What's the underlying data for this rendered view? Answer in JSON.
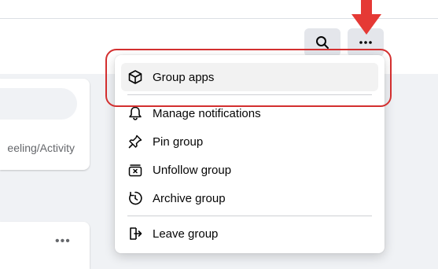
{
  "menu": {
    "items": [
      {
        "label": "Group apps",
        "icon": "cube-icon"
      },
      {
        "label": "Manage notifications",
        "icon": "bell-icon"
      },
      {
        "label": "Pin group",
        "icon": "pin-icon"
      },
      {
        "label": "Unfollow group",
        "icon": "unfollow-icon"
      },
      {
        "label": "Archive group",
        "icon": "archive-icon"
      },
      {
        "label": "Leave group",
        "icon": "exit-icon"
      }
    ]
  },
  "left_panel": {
    "fragment_text": "eeling/Activity"
  },
  "colors": {
    "annotation": "#e53935",
    "menu_hover": "#f2f2f2",
    "toolbar_button": "#e4e6eb"
  }
}
